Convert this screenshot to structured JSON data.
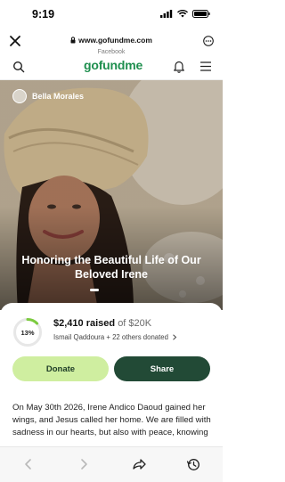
{
  "status_bar": {
    "time": "9:19"
  },
  "browser": {
    "url": "www.gofundme.com",
    "source": "Facebook"
  },
  "header": {
    "logo": "gofundme"
  },
  "hero": {
    "organizer": "Bella Morales",
    "title": "Honoring the Beautiful Life of Our Beloved Irene"
  },
  "campaign": {
    "percent_label": "13%",
    "percent_value": 13,
    "raised": "$2,410 raised",
    "goal": "of $20K",
    "donors": "Ismail Qaddoura + 22 others donated"
  },
  "actions": {
    "donate_label": "Donate",
    "share_label": "Share"
  },
  "story": {
    "text": "On May 30th 2026, Irene Andico Daoud gained her wings, and Jesus called her home. We are filled with sadness in our hearts, but also with peace, knowing"
  },
  "colors": {
    "brand_green": "#1f8f4f",
    "donate_bg": "#cfeea0",
    "share_bg": "#224a36",
    "progress_green": "#7ccb3f"
  },
  "icons": [
    "close-icon",
    "lock-icon",
    "more-icon",
    "search-icon",
    "bell-icon",
    "menu-icon",
    "back-icon",
    "forward-icon",
    "share-icon",
    "history-icon",
    "chevron-right-icon"
  ]
}
